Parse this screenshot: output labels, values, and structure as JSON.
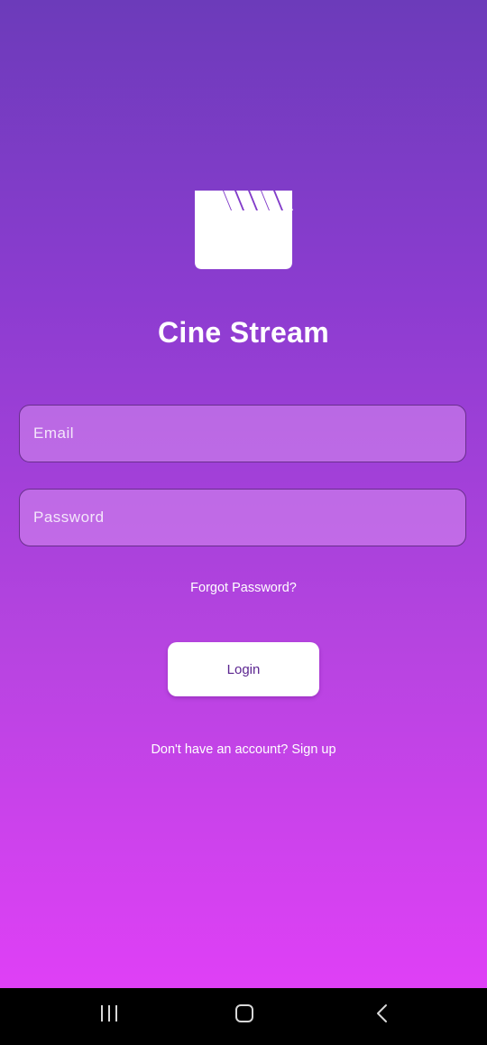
{
  "app": {
    "title": "Cine Stream",
    "logo_icon": "movie-clapperboard-icon"
  },
  "form": {
    "email_placeholder": "Email",
    "password_placeholder": "Password",
    "forgot_label": "Forgot Password?",
    "login_label": "Login",
    "signup_label": "Don't have an account? Sign up"
  },
  "colors": {
    "gradient_top": "#6c3bba",
    "gradient_bottom": "#df40f6",
    "button_text": "#5b2590",
    "field_border": "#6a2f8e"
  },
  "system_nav": {
    "recent_icon": "recent-apps-icon",
    "home_icon": "home-icon",
    "back_icon": "back-icon"
  }
}
